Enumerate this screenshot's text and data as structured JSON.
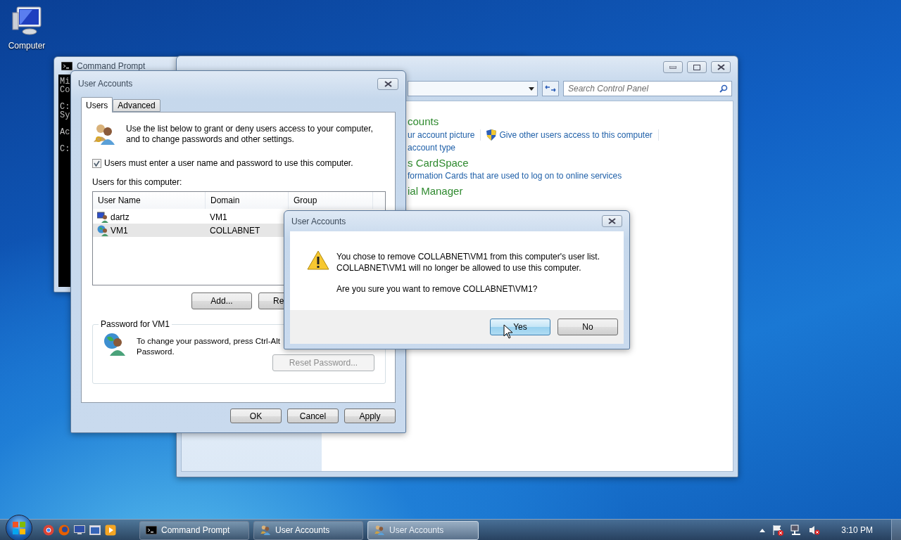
{
  "desktop_icons": [
    {
      "label": "Computer"
    }
  ],
  "command_prompt": {
    "title": "Command Prompt",
    "console_blocks": [
      [
        "Mi",
        "Co"
      ],
      [
        "C:",
        "Sy"
      ],
      [
        "Ac"
      ],
      [
        "C:"
      ]
    ]
  },
  "control_panel": {
    "search": {
      "placeholder": "Search Control Panel"
    },
    "sections": [
      {
        "heading": "counts",
        "rows": [
          [
            {
              "text": "ur account picture",
              "kind": "plain"
            },
            {
              "text": "Give other users access to this computer",
              "kind": "shield"
            }
          ],
          [
            {
              "text": "account type",
              "kind": "plain"
            }
          ]
        ]
      },
      {
        "heading": "s CardSpace",
        "rows": [
          [
            {
              "text": "formation Cards that are used to log on to online services",
              "kind": "plain"
            }
          ]
        ]
      },
      {
        "heading": "ial Manager"
      }
    ]
  },
  "user_accounts": {
    "title": "User Accounts",
    "tabs": [
      {
        "label": "Users",
        "selected": true
      },
      {
        "label": "Advanced",
        "selected": false
      }
    ],
    "intro_lines": [
      "Use the list below to grant or deny users access to your computer,",
      "and to change passwords and other settings."
    ],
    "require_login": {
      "label": "Users must enter a user name and password to use this computer.",
      "checked": true
    },
    "list_label": "Users for this computer:",
    "columns": [
      "User Name",
      "Domain",
      "Group"
    ],
    "rows": [
      {
        "name": "dartz",
        "domain": "VM1",
        "kind": "local",
        "selected": false
      },
      {
        "name": "VM1",
        "domain": "COLLABNET",
        "kind": "domain",
        "selected": true
      }
    ],
    "list_buttons": [
      "Add...",
      "Re"
    ],
    "password_group": {
      "title": "Password for VM1",
      "text_lines": [
        "To change your password, press Ctrl-Alt",
        "Password."
      ]
    },
    "reset_button": {
      "label": "Reset Password...",
      "disabled": true
    },
    "footer_buttons": [
      "OK",
      "Cancel",
      "Apply"
    ]
  },
  "dialog": {
    "title": "User Accounts",
    "message_lines": [
      "You chose to remove COLLABNET\\VM1 from this computer's user list.",
      "COLLABNET\\VM1 will no longer be allowed to use this computer."
    ],
    "question": "Are you sure you want to remove COLLABNET\\VM1?",
    "buttons": [
      {
        "label": "Yes",
        "default": true
      },
      {
        "label": "No",
        "default": false
      }
    ]
  },
  "taskbar": {
    "buttons": [
      {
        "label": "Command Prompt",
        "kind": "cmd",
        "selected": false
      },
      {
        "label": "User Accounts",
        "kind": "users",
        "selected": false
      },
      {
        "label": "User Accounts",
        "kind": "users",
        "selected": true
      }
    ],
    "clock": "3:10 PM"
  }
}
